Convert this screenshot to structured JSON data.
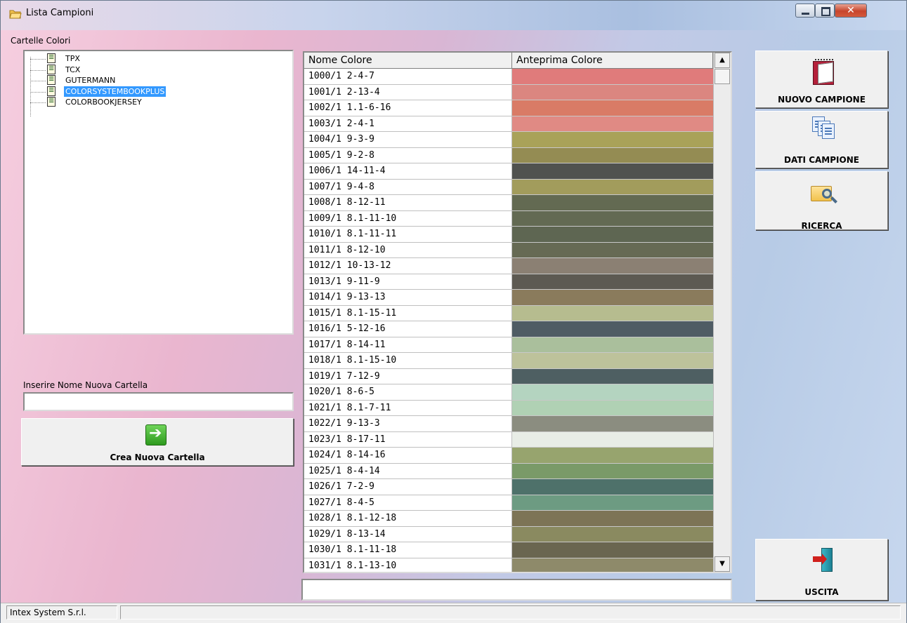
{
  "window": {
    "title": "Lista Campioni"
  },
  "left": {
    "group_label": "Cartelle Colori",
    "folders": [
      {
        "label": "TPX",
        "selected": false
      },
      {
        "label": "TCX",
        "selected": false
      },
      {
        "label": "GUTERMANN",
        "selected": false
      },
      {
        "label": "COLORSYSTEMBOOKPLUS",
        "selected": true
      },
      {
        "label": "COLORBOOKJERSEY",
        "selected": false
      }
    ],
    "new_folder_label": "Inserire Nome Nuova Cartella",
    "new_folder_value": "",
    "create_button": "Crea Nuova Cartella"
  },
  "grid": {
    "columns": [
      "Nome Colore",
      "Anteprima Colore"
    ],
    "rows": [
      {
        "name": "1000/1  2-4-7",
        "color": "#e07b7b"
      },
      {
        "name": "1001/1  2-13-4",
        "color": "#db8680"
      },
      {
        "name": "1002/1  1.1-6-16",
        "color": "#d97b66"
      },
      {
        "name": "1003/1  2-4-1",
        "color": "#e08a84"
      },
      {
        "name": "1004/1  9-3-9",
        "color": "#a9a259"
      },
      {
        "name": "1005/1  9-2-8",
        "color": "#948c53"
      },
      {
        "name": "1006/1  14-11-4",
        "color": "#50524f"
      },
      {
        "name": "1007/1  9-4-8",
        "color": "#a29c5c"
      },
      {
        "name": "1008/1  8-12-11",
        "color": "#636a52"
      },
      {
        "name": "1009/1  8.1-11-10",
        "color": "#636a53"
      },
      {
        "name": "1010/1  8.1-11-11",
        "color": "#5e6652"
      },
      {
        "name": "1011/1  8-12-10",
        "color": "#666a54"
      },
      {
        "name": "1012/1  10-13-12",
        "color": "#8b8073"
      },
      {
        "name": "1013/1  9-11-9",
        "color": "#5d5a52"
      },
      {
        "name": "1014/1  9-13-13",
        "color": "#8a7b5c"
      },
      {
        "name": "1015/1  8.1-15-11",
        "color": "#b6bc8f"
      },
      {
        "name": "1016/1  5-12-16",
        "color": "#4f5c64"
      },
      {
        "name": "1017/1  8-14-11",
        "color": "#aabf9c"
      },
      {
        "name": "1018/1  8.1-15-10",
        "color": "#bdc29b"
      },
      {
        "name": "1019/1  7-12-9",
        "color": "#4e5f62"
      },
      {
        "name": "1020/1  8-6-5",
        "color": "#b4d4c0"
      },
      {
        "name": "1021/1  8.1-7-11",
        "color": "#b0d1b4"
      },
      {
        "name": "1022/1  9-13-3",
        "color": "#8b8d80"
      },
      {
        "name": "1023/1  8-17-11",
        "color": "#e8ede6"
      },
      {
        "name": "1024/1  8-14-16",
        "color": "#97a46e"
      },
      {
        "name": "1025/1  8-4-14",
        "color": "#7a9a68"
      },
      {
        "name": "1026/1  7-2-9",
        "color": "#4e716a"
      },
      {
        "name": "1027/1  8-4-5",
        "color": "#6d9b82"
      },
      {
        "name": "1028/1  8.1-12-18",
        "color": "#7d7456"
      },
      {
        "name": "1029/1  8-13-14",
        "color": "#8a8a60"
      },
      {
        "name": "1030/1  8.1-11-18",
        "color": "#6a6650"
      },
      {
        "name": "1031/1  8.1-13-10",
        "color": "#8e8a6a"
      }
    ]
  },
  "status_field_value": "",
  "right": {
    "nuovo": "NUOVO CAMPIONE",
    "dati": "DATI CAMPIONE",
    "ricerca": "RICERCA",
    "uscita": "USCITA"
  },
  "statusbar": {
    "company": "Intex System S.r.l."
  }
}
